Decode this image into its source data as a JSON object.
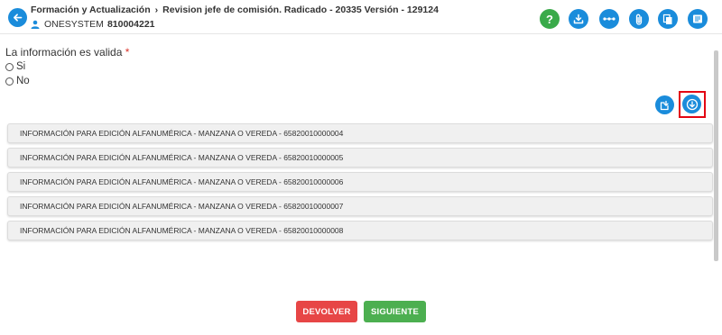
{
  "header": {
    "breadcrumb_root": "Formación y Actualización",
    "breadcrumb_current": "Revision jefe de comisión. Radicado - 20335 Versión - 129124",
    "user_name": "ONESYSTEM",
    "user_id": "810004221"
  },
  "toolbar": {
    "icons": [
      "help-icon",
      "download-icon",
      "workflow-icon",
      "attachment-icon",
      "copy-document-icon",
      "form-list-icon"
    ],
    "colors": {
      "primary": "#1a8cdb",
      "help": "#3aaa4a"
    }
  },
  "form": {
    "question": "La información es valida",
    "required_mark": "*",
    "options": [
      {
        "label": "Si"
      },
      {
        "label": "No"
      }
    ]
  },
  "panels": [
    {
      "label": "INFORMACIÓN PARA EDICIÓN ALFANUMÉRICA - MANZANA O VEREDA - 65820010000004"
    },
    {
      "label": "INFORMACIÓN PARA EDICIÓN ALFANUMÉRICA - MANZANA O VEREDA - 65820010000005"
    },
    {
      "label": "INFORMACIÓN PARA EDICIÓN ALFANUMÉRICA - MANZANA O VEREDA - 65820010000006"
    },
    {
      "label": "INFORMACIÓN PARA EDICIÓN ALFANUMÉRICA - MANZANA O VEREDA - 65820010000007"
    },
    {
      "label": "INFORMACIÓN PARA EDICIÓN ALFANUMÉRICA - MANZANA O VEREDA - 65820010000008"
    }
  ],
  "footer": {
    "return_label": "DEVOLVER",
    "next_label": "SIGUIENTE",
    "colors": {
      "return": "#e74646",
      "next": "#4caf50"
    }
  }
}
